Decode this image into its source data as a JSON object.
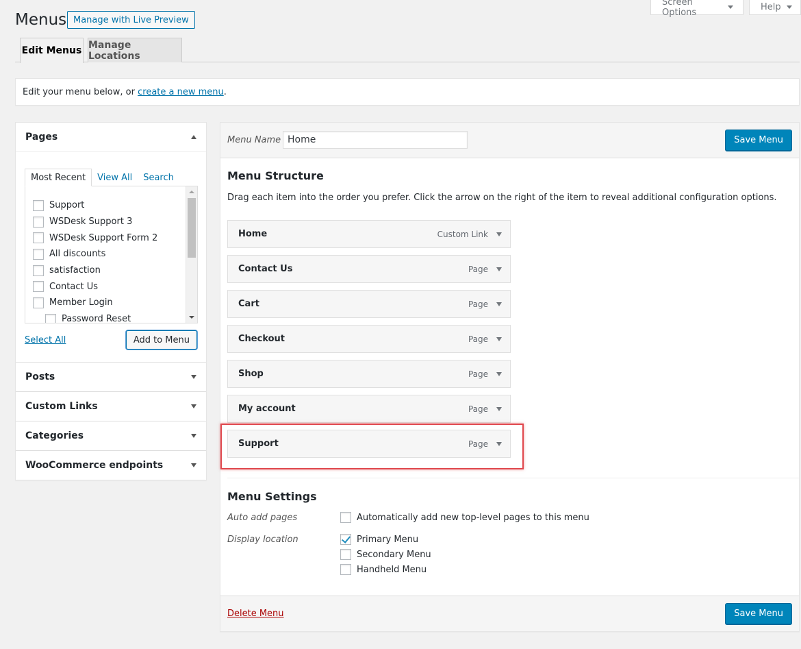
{
  "header": {
    "title": "Menus",
    "live_preview": "Manage with Live Preview",
    "screen_options": "Screen Options",
    "help": "Help"
  },
  "tabs": {
    "edit_menus": "Edit Menus",
    "manage_locations": "Manage Locations"
  },
  "intro": {
    "text": "Edit your menu below, or ",
    "link": "create a new menu",
    "end": "."
  },
  "sidebar": {
    "pages": {
      "title": "Pages",
      "tabs": [
        "Most Recent",
        "View All",
        "Search"
      ],
      "items": [
        {
          "label": "Support",
          "child": false
        },
        {
          "label": "WSDesk Support 3",
          "child": false
        },
        {
          "label": "WSDesk Support Form 2",
          "child": false
        },
        {
          "label": "All discounts",
          "child": false
        },
        {
          "label": "satisfaction",
          "child": false
        },
        {
          "label": "Contact Us",
          "child": false
        },
        {
          "label": "Member Login",
          "child": false
        },
        {
          "label": "Password Reset",
          "child": true
        }
      ],
      "select_all": "Select All",
      "add_to_menu": "Add to Menu"
    },
    "sections": [
      "Posts",
      "Custom Links",
      "Categories",
      "WooCommerce endpoints"
    ]
  },
  "menu": {
    "name_label": "Menu Name",
    "name_value": "Home",
    "save_label": "Save Menu",
    "structure_title": "Menu Structure",
    "structure_desc": "Drag each item into the order you prefer. Click the arrow on the right of the item to reveal additional configuration options.",
    "items": [
      {
        "title": "Home",
        "type": "Custom Link"
      },
      {
        "title": "Contact Us",
        "type": "Page"
      },
      {
        "title": "Cart",
        "type": "Page"
      },
      {
        "title": "Checkout",
        "type": "Page"
      },
      {
        "title": "Shop",
        "type": "Page"
      },
      {
        "title": "My account",
        "type": "Page"
      },
      {
        "title": "Support",
        "type": "Page"
      }
    ],
    "settings": {
      "title": "Menu Settings",
      "auto_add_label": "Auto add pages",
      "auto_add_option": "Automatically add new top-level pages to this menu",
      "display_location_label": "Display location",
      "locations": [
        {
          "label": "Primary Menu",
          "checked": true
        },
        {
          "label": "Secondary Menu",
          "checked": false
        },
        {
          "label": "Handheld Menu",
          "checked": false
        }
      ]
    },
    "delete_label": "Delete Menu"
  },
  "colors": {
    "primary_button": "#0085ba",
    "link": "#0073aa",
    "delete": "#aa0000",
    "highlight": "#e0474d"
  }
}
